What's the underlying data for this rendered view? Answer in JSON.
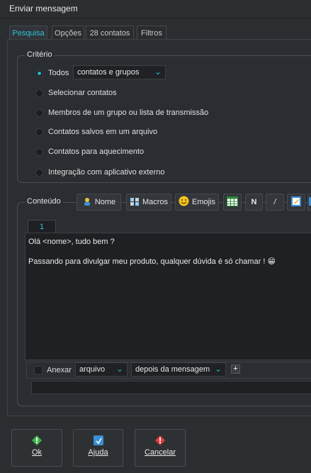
{
  "window": {
    "title": "Enviar mensagem"
  },
  "tabs": [
    {
      "label": "Pesquisa",
      "active": true
    },
    {
      "label": "Opções",
      "active": false
    },
    {
      "label": "28 contatos",
      "active": false
    },
    {
      "label": "Filtros",
      "active": false
    }
  ],
  "criterio": {
    "title": "Critério",
    "options": [
      {
        "label": "Todos",
        "selected": true
      },
      {
        "label": "Selecionar contatos",
        "selected": false
      },
      {
        "label": "Membros de um grupo ou lista de transmissão",
        "selected": false
      },
      {
        "label": "Contatos salvos em um arquivo",
        "selected": false
      },
      {
        "label": "Contatos para aquecimento",
        "selected": false
      },
      {
        "label": "Integração com aplicativo externo",
        "selected": false
      }
    ],
    "todos_combo": "contatos e grupos"
  },
  "conteudo": {
    "title": "Conteúdo",
    "toolbar": {
      "nome_label": "Nome",
      "macros_label": "Macros",
      "emojis_label": "Emojis",
      "bold_label": "N",
      "italic_label": "/"
    },
    "editor_tab": "1",
    "message_lines": [
      "Olá <nome>, tudo bem ?",
      "",
      "Passando para divulgar meu produto, qualquer dúvida é só chamar ! 😁"
    ],
    "anexar_label": "Anexar",
    "anexo_tipo": "arquivo",
    "anexo_posicao": "depois da mensagem",
    "add_label": "+"
  },
  "footer": {
    "ok_label": "Ok",
    "ajuda_label": "Ajuda",
    "cancelar_label": "Cancelar"
  },
  "colors": {
    "accent": "#2ec4d6",
    "ok_icon": "#3fb54a",
    "help_icon": "#3b8fd6",
    "cancel_icon": "#e23c3c"
  }
}
